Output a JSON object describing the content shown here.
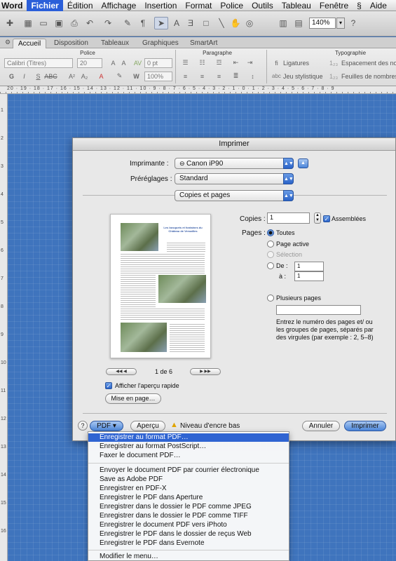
{
  "menubar": {
    "app": "Word",
    "items": [
      "Fichier",
      "Édition",
      "Affichage",
      "Insertion",
      "Format",
      "Police",
      "Outils",
      "Tableau",
      "Fenêtre",
      "Aide"
    ]
  },
  "toolbar": {
    "zoom": "140%"
  },
  "ribbon": {
    "tabs": [
      "Accueil",
      "Disposition",
      "Tableaux",
      "Graphiques",
      "SmartArt"
    ],
    "groups": [
      "Police",
      "Paragraphe",
      "Typographie"
    ],
    "font_name": "Calibri (Titres)",
    "font_size": "20",
    "spacing": "0 pt",
    "scale": "100%",
    "ligatures": "Ligatures",
    "jeu_stylistique": "Jeu stylistique",
    "espacement": "Espacement des nombres",
    "feuilles": "Feuilles de nombres"
  },
  "ruler": {
    "label": "20 · 19 · 18 · 17 · 16 · 15 · 14 · 13 · 12 · 11 · 10 · 9 · 8 · 7 · 6 · 5 · 4 · 3 · 2 · 1 · 0 · 1 · 2 · 3 · 4 · 5 · 6 · 7 · 8 · 9"
  },
  "print_dialog": {
    "title": "Imprimer",
    "printer_label": "Imprimante :",
    "printer_value": "Canon iP90",
    "presets_label": "Préréglages :",
    "presets_value": "Standard",
    "section_value": "Copies et pages",
    "copies_label": "Copies :",
    "copies_value": "1",
    "collated_label": "Assemblées",
    "pages_label": "Pages :",
    "opt_all": "Toutes",
    "opt_current": "Page active",
    "opt_selection": "Sélection",
    "opt_from": "De :",
    "from_value": "1",
    "opt_to": "à :",
    "to_value": "1",
    "opt_multiple": "Plusieurs pages",
    "help_text": "Entrez le numéro des pages et/ ou les groupes de pages, séparés par des virgules (par exemple : 2, 5–8)",
    "page_counter": "1 de 6",
    "quick_preview_label": "Afficher l'aperçu rapide",
    "page_setup_button": "Mise en page…",
    "help_button": "?",
    "pdf_button": "PDF ▾",
    "preview_button": "Aperçu",
    "ink_warning": "Niveau d'encre bas",
    "cancel_button": "Annuler",
    "print_button": "Imprimer",
    "doc_title": "Les bosquets et fontaines du Château de Versailles"
  },
  "pdf_menu": {
    "items": [
      "Enregistrer au format PDF…",
      "Enregistrer au format PostScript…",
      "Faxer le document PDF…",
      "Envoyer le document PDF par courrier électronique",
      "Save as Adobe PDF",
      "Enregistrer en PDF-X",
      "Enregistrer le PDF dans Aperture",
      "Enregistrer dans le dossier le PDF comme JPEG",
      "Enregistrer dans le dossier le PDF comme TIFF",
      "Enregistrer le document PDF vers iPhoto",
      "Enregistrer le PDF dans le dossier de reçus Web",
      "Enregistrer le PDF dans Evernote",
      "Modifier le menu…"
    ]
  },
  "colors": {
    "accent": "#2f64d2",
    "background": "#3f74bd"
  }
}
